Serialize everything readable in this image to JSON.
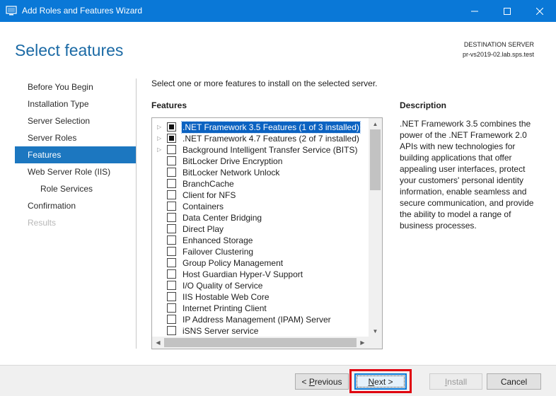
{
  "window": {
    "title": "Add Roles and Features Wizard",
    "controls": [
      "minimize-icon",
      "maximize-icon",
      "close-icon"
    ]
  },
  "header": {
    "page_title": "Select features",
    "destination_label": "DESTINATION SERVER",
    "destination_value": "pr-vs2019-02.lab.sps.test"
  },
  "nav": {
    "items": [
      {
        "label": "Before You Begin",
        "state": "normal"
      },
      {
        "label": "Installation Type",
        "state": "normal"
      },
      {
        "label": "Server Selection",
        "state": "normal"
      },
      {
        "label": "Server Roles",
        "state": "normal"
      },
      {
        "label": "Features",
        "state": "active"
      },
      {
        "label": "Web Server Role (IIS)",
        "state": "normal"
      },
      {
        "label": "Role Services",
        "state": "sub"
      },
      {
        "label": "Confirmation",
        "state": "normal"
      },
      {
        "label": "Results",
        "state": "disabled"
      }
    ]
  },
  "main": {
    "intro": "Select one or more features to install on the selected server.",
    "features_heading": "Features",
    "features": [
      {
        "label": ".NET Framework 3.5 Features (1 of 3 installed)",
        "expandable": true,
        "check": "partial",
        "selected": true
      },
      {
        "label": ".NET Framework 4.7 Features (2 of 7 installed)",
        "expandable": true,
        "check": "partial",
        "selected": false
      },
      {
        "label": "Background Intelligent Transfer Service (BITS)",
        "expandable": true,
        "check": "unchecked",
        "selected": false
      },
      {
        "label": "BitLocker Drive Encryption",
        "expandable": false,
        "check": "unchecked",
        "selected": false
      },
      {
        "label": "BitLocker Network Unlock",
        "expandable": false,
        "check": "unchecked",
        "selected": false
      },
      {
        "label": "BranchCache",
        "expandable": false,
        "check": "unchecked",
        "selected": false
      },
      {
        "label": "Client for NFS",
        "expandable": false,
        "check": "unchecked",
        "selected": false
      },
      {
        "label": "Containers",
        "expandable": false,
        "check": "unchecked",
        "selected": false
      },
      {
        "label": "Data Center Bridging",
        "expandable": false,
        "check": "unchecked",
        "selected": false
      },
      {
        "label": "Direct Play",
        "expandable": false,
        "check": "unchecked",
        "selected": false
      },
      {
        "label": "Enhanced Storage",
        "expandable": false,
        "check": "unchecked",
        "selected": false
      },
      {
        "label": "Failover Clustering",
        "expandable": false,
        "check": "unchecked",
        "selected": false
      },
      {
        "label": "Group Policy Management",
        "expandable": false,
        "check": "unchecked",
        "selected": false
      },
      {
        "label": "Host Guardian Hyper-V Support",
        "expandable": false,
        "check": "unchecked",
        "selected": false
      },
      {
        "label": "I/O Quality of Service",
        "expandable": false,
        "check": "unchecked",
        "selected": false
      },
      {
        "label": "IIS Hostable Web Core",
        "expandable": false,
        "check": "unchecked",
        "selected": false
      },
      {
        "label": "Internet Printing Client",
        "expandable": false,
        "check": "unchecked",
        "selected": false
      },
      {
        "label": "IP Address Management (IPAM) Server",
        "expandable": false,
        "check": "unchecked",
        "selected": false
      },
      {
        "label": "iSNS Server service",
        "expandable": false,
        "check": "unchecked",
        "selected": false
      }
    ],
    "description_heading": "Description",
    "description_text": ".NET Framework 3.5 combines the power of the .NET Framework 2.0 APIs with new technologies for building applications that offer appealing user interfaces, protect your customers' personal identity information, enable seamless and secure communication, and provide the ability to model a range of business processes."
  },
  "footer": {
    "previous": {
      "pre": "< ",
      "accel": "P",
      "post": "revious"
    },
    "next": {
      "accel": "N",
      "post": "ext >"
    },
    "install": {
      "accel": "I",
      "post": "nstall"
    },
    "cancel": "Cancel"
  },
  "colors": {
    "titlebar": "#0a78d7",
    "nav_active": "#1c77c0",
    "page_title": "#1b6aa5",
    "highlight_box": "#e0000f",
    "selection": "#0b62c1"
  }
}
